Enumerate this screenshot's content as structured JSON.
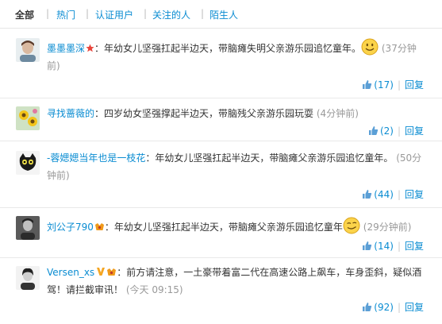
{
  "tabs": [
    {
      "label": "全部"
    },
    {
      "label": "热门"
    },
    {
      "label": "认证用户"
    },
    {
      "label": "关注的人"
    },
    {
      "label": "陌生人"
    }
  ],
  "tab_separator": "|",
  "comments": [
    {
      "user": "墨墨墨深",
      "sep": "：",
      "text": "年幼女儿坚强扛起半边天，带脑瘫失明父亲游乐园追忆童年。",
      "time_line1": "(37分钟",
      "time_line2": "前)",
      "likes": "(17)",
      "reply": "回复"
    },
    {
      "user": "寻找蔷薇的",
      "sep": "：",
      "text": "四岁幼女坚强撑起半边天，带脑残父亲游乐园玩耍",
      "time": "(4分钟前)",
      "likes": "(2)",
      "reply": "回复"
    },
    {
      "user": "-蓉媤媤当年也是一枝花",
      "sep": "：",
      "text": "年幼女儿坚强扛起半边天，带脑瘫父亲游乐园追忆童年。",
      "time_line1": "(50分",
      "time_line2": "钟前)",
      "likes": "(44)",
      "reply": "回复"
    },
    {
      "user": "刘公子790",
      "sep": "：",
      "text": "年幼女儿坚强扛起半边天，带脑瘫父亲游乐园追忆童年",
      "time": "(29分钟前)",
      "likes": "(14)",
      "reply": "回复"
    },
    {
      "user": "Versen_xs",
      "sep": "：",
      "text_line1": "前方请注意，一土豪带着富二代在高速公路上飙车，车身歪斜，疑似酒",
      "text_line2": "驾！请拦截审讯！",
      "time": "(今天 09:15)",
      "likes": "(92)",
      "reply": "回复"
    }
  ],
  "action_separator": "|",
  "colors": {
    "link": "#0a8cd2",
    "text": "#333333",
    "muted": "#999999",
    "divider": "#e9e9e9"
  },
  "icons": [
    "thumbs-up-icon",
    "smiley-emoji-icon",
    "wink-emoji-icon",
    "verified-badge-icon",
    "vip-badge-icon",
    "red-star-badge-icon"
  ]
}
